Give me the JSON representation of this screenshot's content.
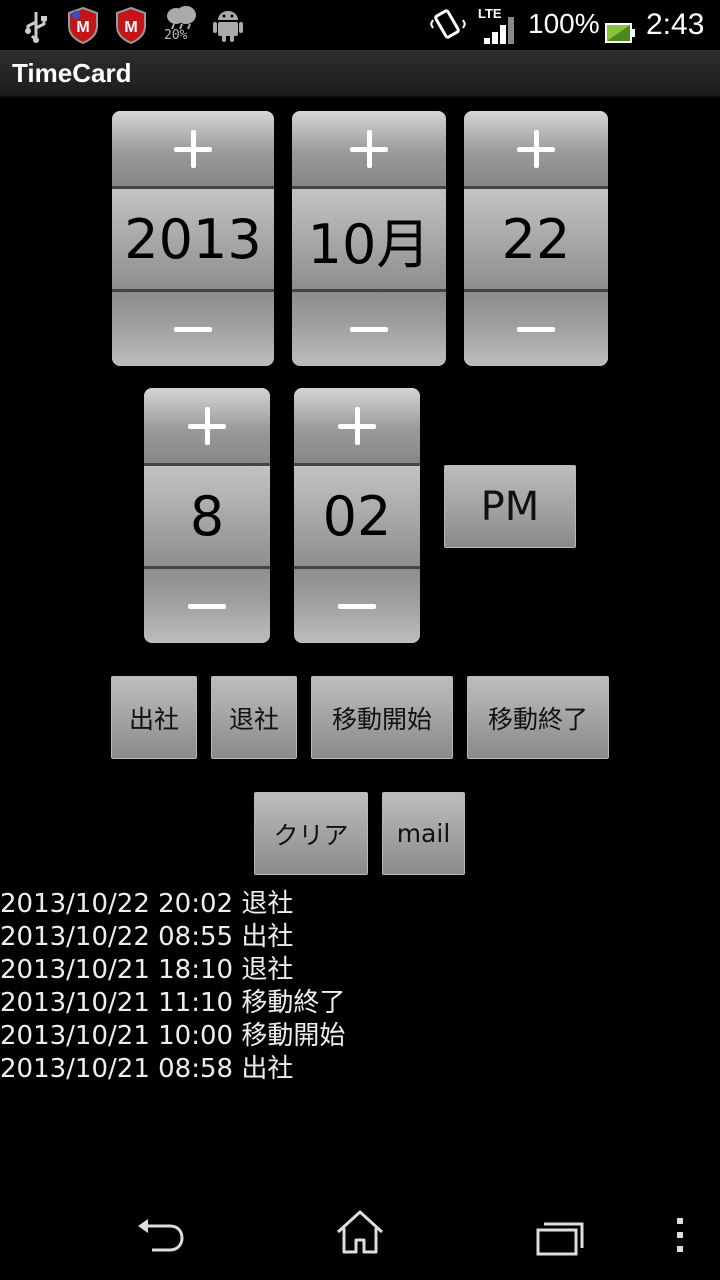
{
  "status_bar": {
    "icons": [
      "usb-icon",
      "mcafee-icon",
      "mcafee-icon",
      "weather-icon",
      "android-icon",
      "vibrate-icon",
      "signal-icon",
      "battery-icon"
    ],
    "weather_percent": "20%",
    "network": "LTE",
    "battery": "100%",
    "time": "2:43"
  },
  "action_bar": {
    "title": "TimeCard"
  },
  "date_pickers": {
    "year": "2013",
    "month": "10月",
    "day": "22"
  },
  "time_pickers": {
    "hour": "8",
    "minute": "02",
    "ampm": "PM"
  },
  "actions": {
    "clock_in": "出社",
    "clock_out": "退社",
    "move_start": "移動開始",
    "move_end": "移動終了",
    "clear": "クリア",
    "mail": "mail"
  },
  "log": [
    "2013/10/22 20:02 退社",
    "2013/10/22 08:55 出社",
    "2013/10/21 18:10 退社",
    "2013/10/21 11:10 移動終了",
    "2013/10/21 10:00 移動開始",
    "2013/10/21 08:58 出社"
  ],
  "nav_bar": {
    "buttons": [
      "back-icon",
      "home-icon",
      "recents-icon",
      "menu-icon"
    ]
  }
}
